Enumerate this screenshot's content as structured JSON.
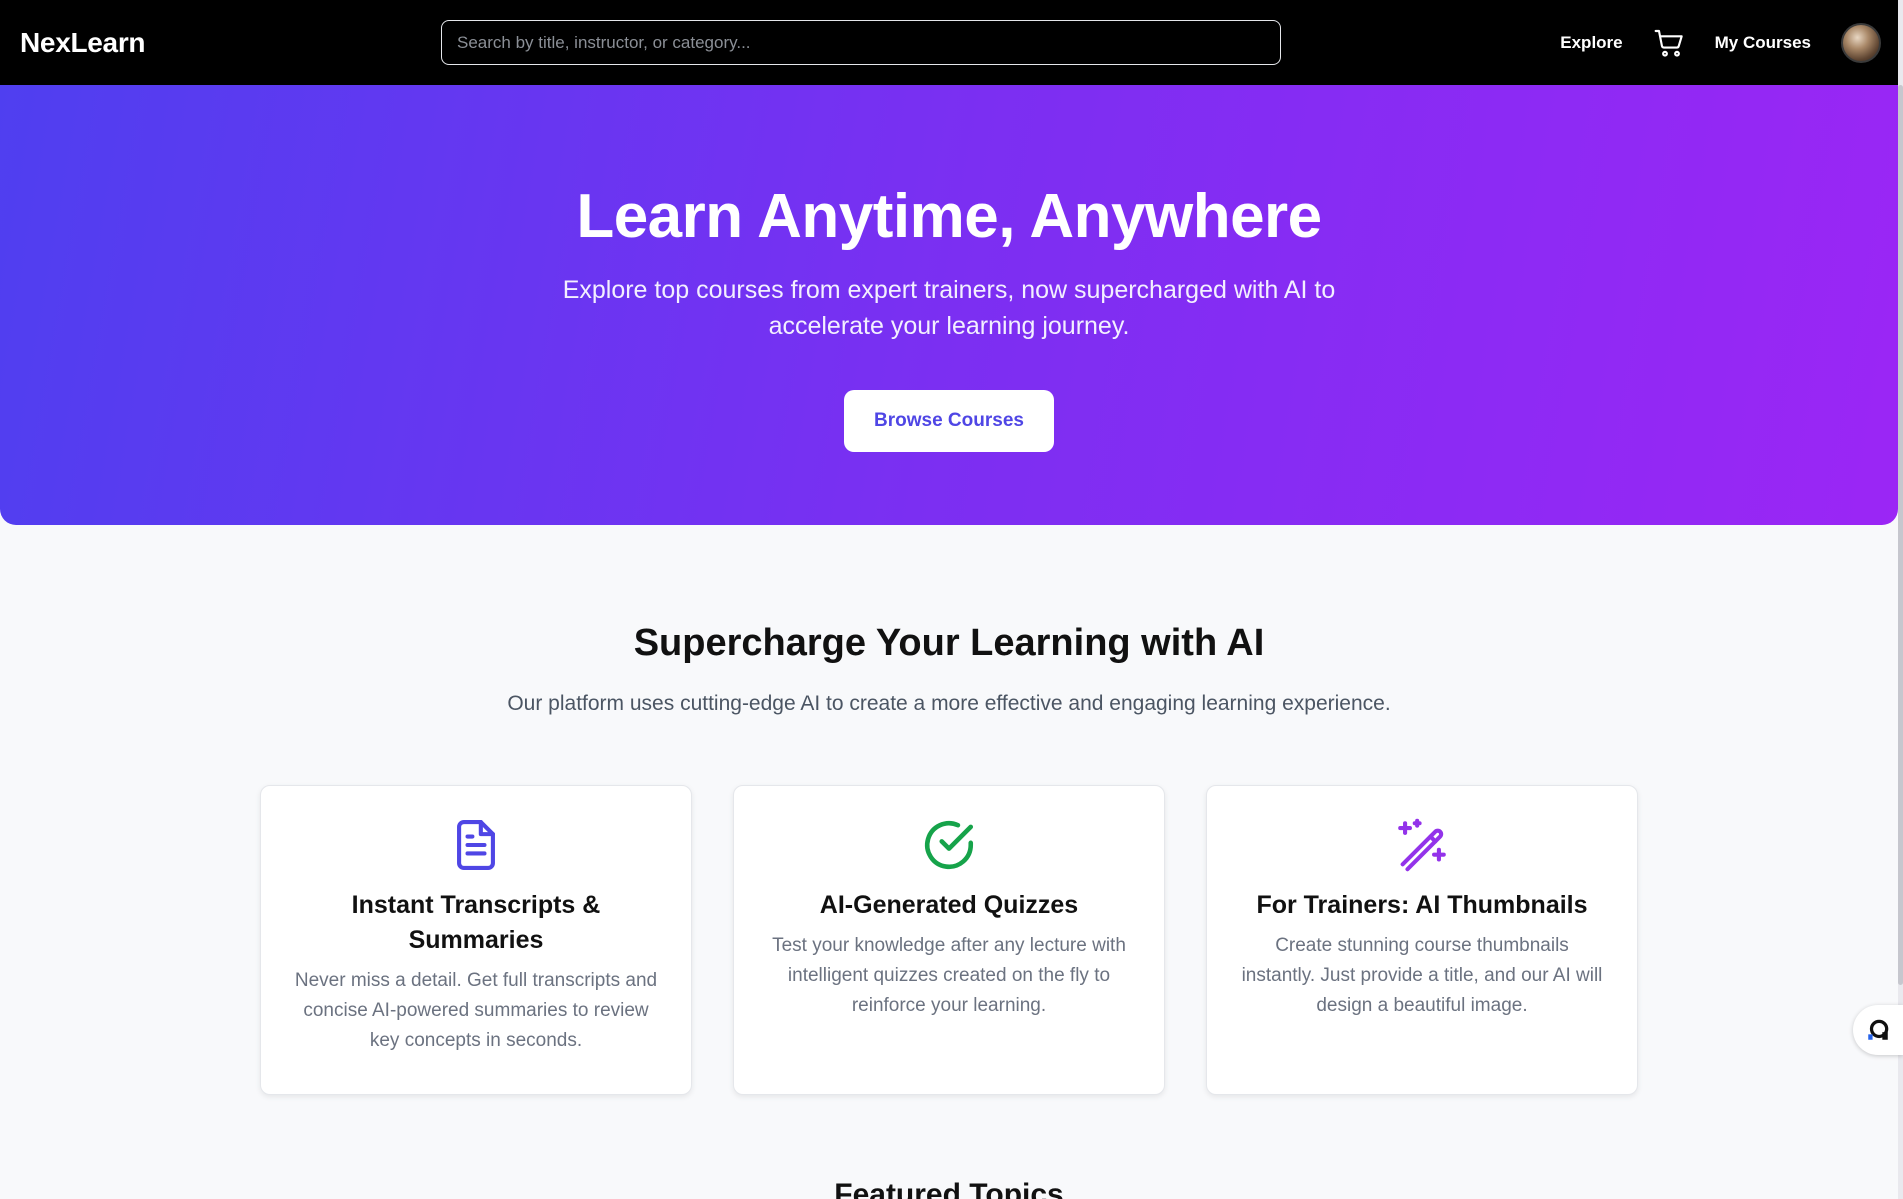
{
  "header": {
    "brand": "NexLearn",
    "search_placeholder": "Search by title, instructor, or category...",
    "nav": {
      "explore": "Explore",
      "my_courses": "My Courses"
    },
    "icons": {
      "cart": "cart-icon",
      "avatar": "avatar"
    }
  },
  "hero": {
    "title": "Learn Anytime, Anywhere",
    "subtitle": "Explore top courses from expert trainers, now supercharged with AI to accelerate your learning journey.",
    "cta": "Browse Courses",
    "gradient_from": "#4f3ff0",
    "gradient_to": "#9b26f5"
  },
  "features": {
    "title": "Supercharge Your Learning with AI",
    "subtitle": "Our platform uses cutting-edge AI to create a more effective and engaging learning experience.",
    "cards": [
      {
        "icon": "document-icon",
        "icon_color": "#4f46e5",
        "title": "Instant Transcripts & Summaries",
        "body": "Never miss a detail. Get full transcripts and concise AI-powered summaries to review key concepts in seconds."
      },
      {
        "icon": "check-circle-icon",
        "icon_color": "#16a34a",
        "title": "AI-Generated Quizzes",
        "body": "Test your knowledge after any lecture with intelligent quizzes created on the fly to reinforce your learning."
      },
      {
        "icon": "magic-wand-icon",
        "icon_color": "#9333ea",
        "title": "For Trainers: AI Thumbnails",
        "body": "Create stunning course thumbnails instantly. Just provide a title, and our AI will design a beautiful image."
      }
    ]
  },
  "topics": {
    "title": "Featured Topics"
  }
}
